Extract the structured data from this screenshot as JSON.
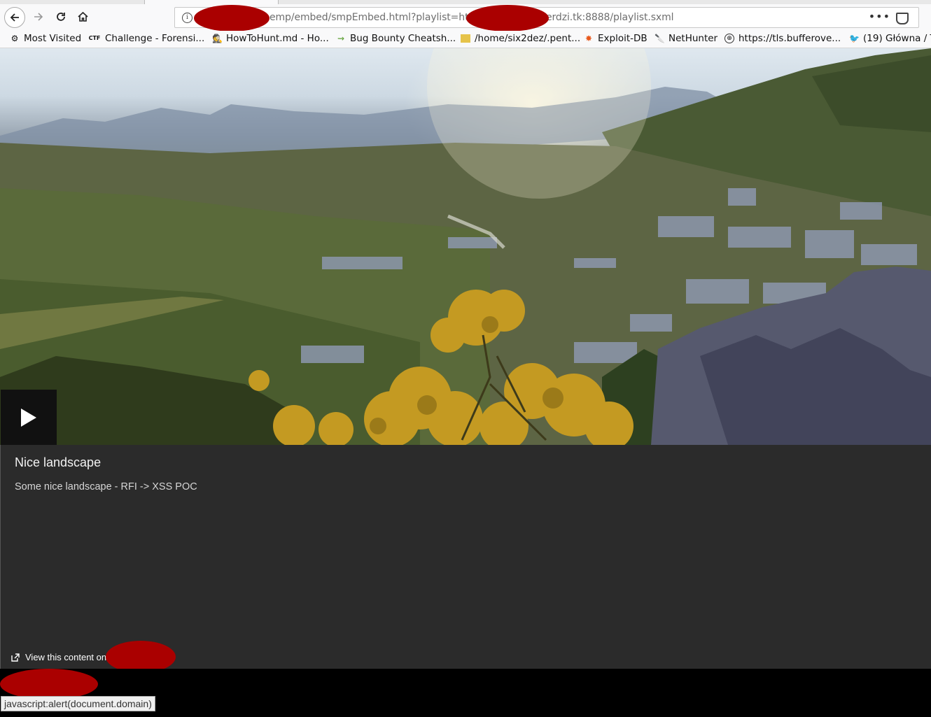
{
  "browser": {
    "url_visible_part1": "emp/embed/smpEmbed.html?playlist=http",
    "url_visible_part2": "erdzi.tk:8888/playlist.sxml",
    "url_menu": "•••",
    "bookmarks": [
      {
        "label": "Most Visited",
        "icon": "gear-icon"
      },
      {
        "label": "Challenge - Forensi...",
        "icon": "ctf-icon"
      },
      {
        "label": "HowToHunt.md - Ho...",
        "icon": "hacker-icon"
      },
      {
        "label": "Bug Bounty Cheatsh...",
        "icon": "bug-icon"
      },
      {
        "label": "/home/six2dez/.pent...",
        "icon": "image-icon"
      },
      {
        "label": "Exploit-DB",
        "icon": "exploit-icon"
      },
      {
        "label": "NetHunter",
        "icon": "knife-icon"
      },
      {
        "label": "https://tls.bufferove...",
        "icon": "globe-icon"
      },
      {
        "label": "(19) Główna / T",
        "icon": "twitter-icon"
      }
    ]
  },
  "video": {
    "title": "Nice landscape",
    "description": "Some nice landscape - RFI -> XSS POC",
    "view_link": "View this content on"
  },
  "status_bar": {
    "text": "javascript:alert(document.domain)"
  },
  "colors": {
    "redaction": "#aa0000",
    "panel_bg": "#2b2b2b"
  }
}
